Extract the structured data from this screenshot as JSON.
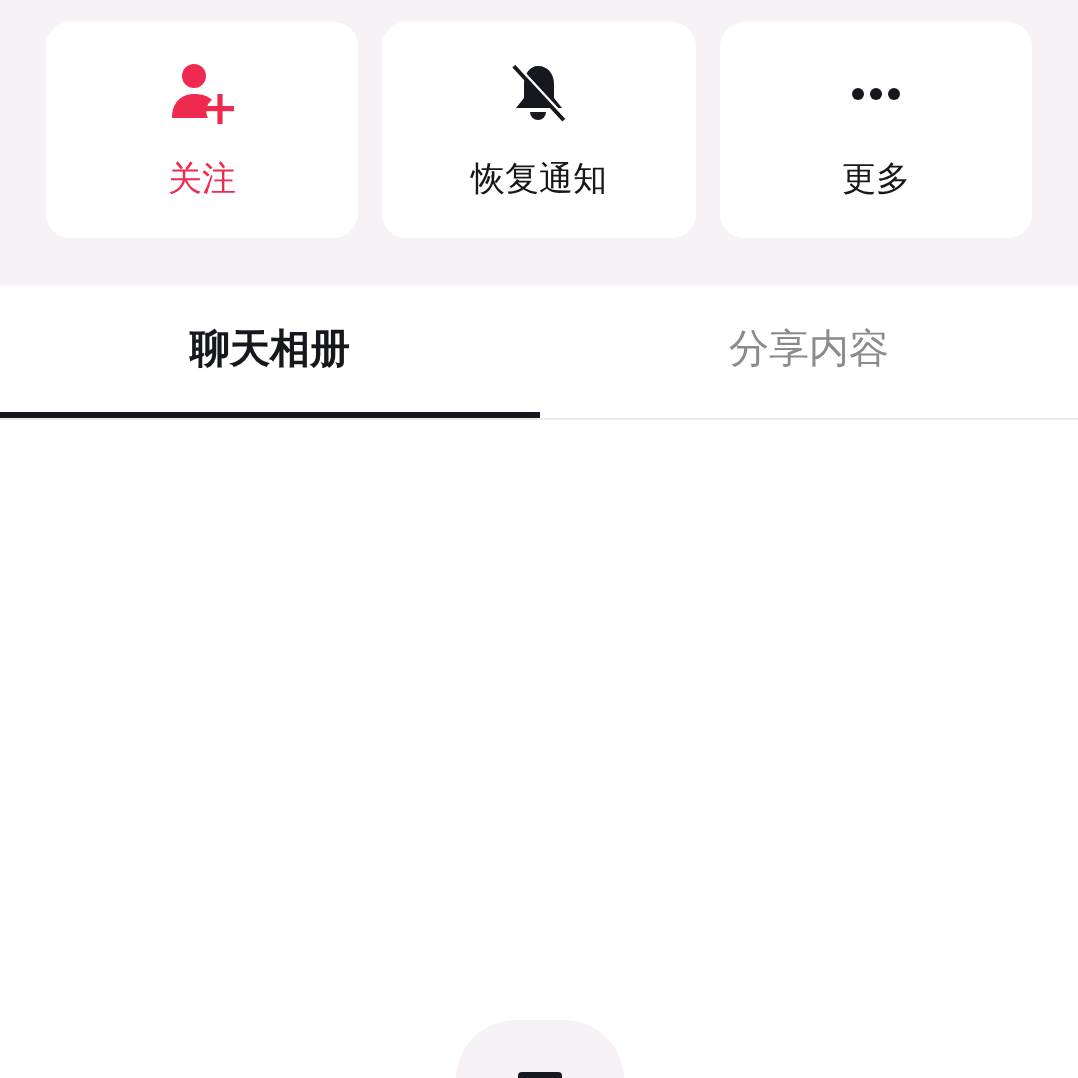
{
  "actions": [
    {
      "kind": "follow",
      "label": "关注",
      "color": "#f0294f"
    },
    {
      "kind": "unmute",
      "label": "恢复通知",
      "color": "#16181d"
    },
    {
      "kind": "more",
      "label": "更多",
      "color": "#16181d"
    }
  ],
  "tabs": [
    {
      "label": "聊天相册",
      "selected": true
    },
    {
      "label": "分享内容",
      "selected": false
    }
  ]
}
